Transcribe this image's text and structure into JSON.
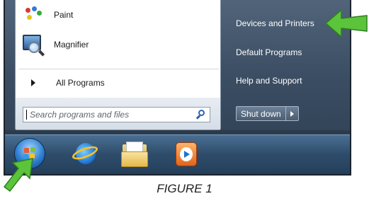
{
  "left_pane": {
    "programs": [
      {
        "label": "Paint",
        "icon": "paint-icon"
      },
      {
        "label": "Magnifier",
        "icon": "magnifier-icon"
      }
    ],
    "all_programs_label": "All Programs",
    "search_placeholder": "Search programs and files"
  },
  "right_pane": {
    "links": [
      "Devices and Printers",
      "Default Programs",
      "Help and Support"
    ],
    "shutdown_label": "Shut down"
  },
  "taskbar": {
    "items": [
      "windows-start-orb",
      "internet-explorer-icon",
      "windows-explorer-icon",
      "windows-media-player-icon"
    ]
  },
  "caption": "FIGURE 1",
  "colors": {
    "arrow": "#5cc43a",
    "menu_bg": "#3b4d62",
    "taskbar": "#2f4d6b"
  }
}
